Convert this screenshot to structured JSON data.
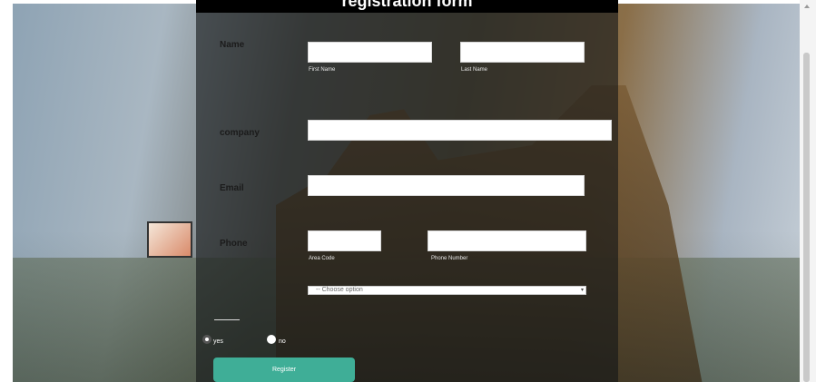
{
  "form": {
    "title": "registration form",
    "labels": {
      "name": "Name",
      "company": "company",
      "email": "Email",
      "phone": "Phone"
    },
    "hints": {
      "first_name": "First Name",
      "last_name": "Last Name",
      "area_code": "Area Code",
      "phone_number": "Phone Number"
    },
    "select": {
      "selected": "-- Choose option"
    },
    "radios": [
      {
        "label": "yes",
        "checked": true
      },
      {
        "label": "no",
        "checked": false
      }
    ],
    "button_label": "Register"
  },
  "icons": {
    "scroll_up": "triangle-up",
    "select_arrow": "chevron-down"
  }
}
